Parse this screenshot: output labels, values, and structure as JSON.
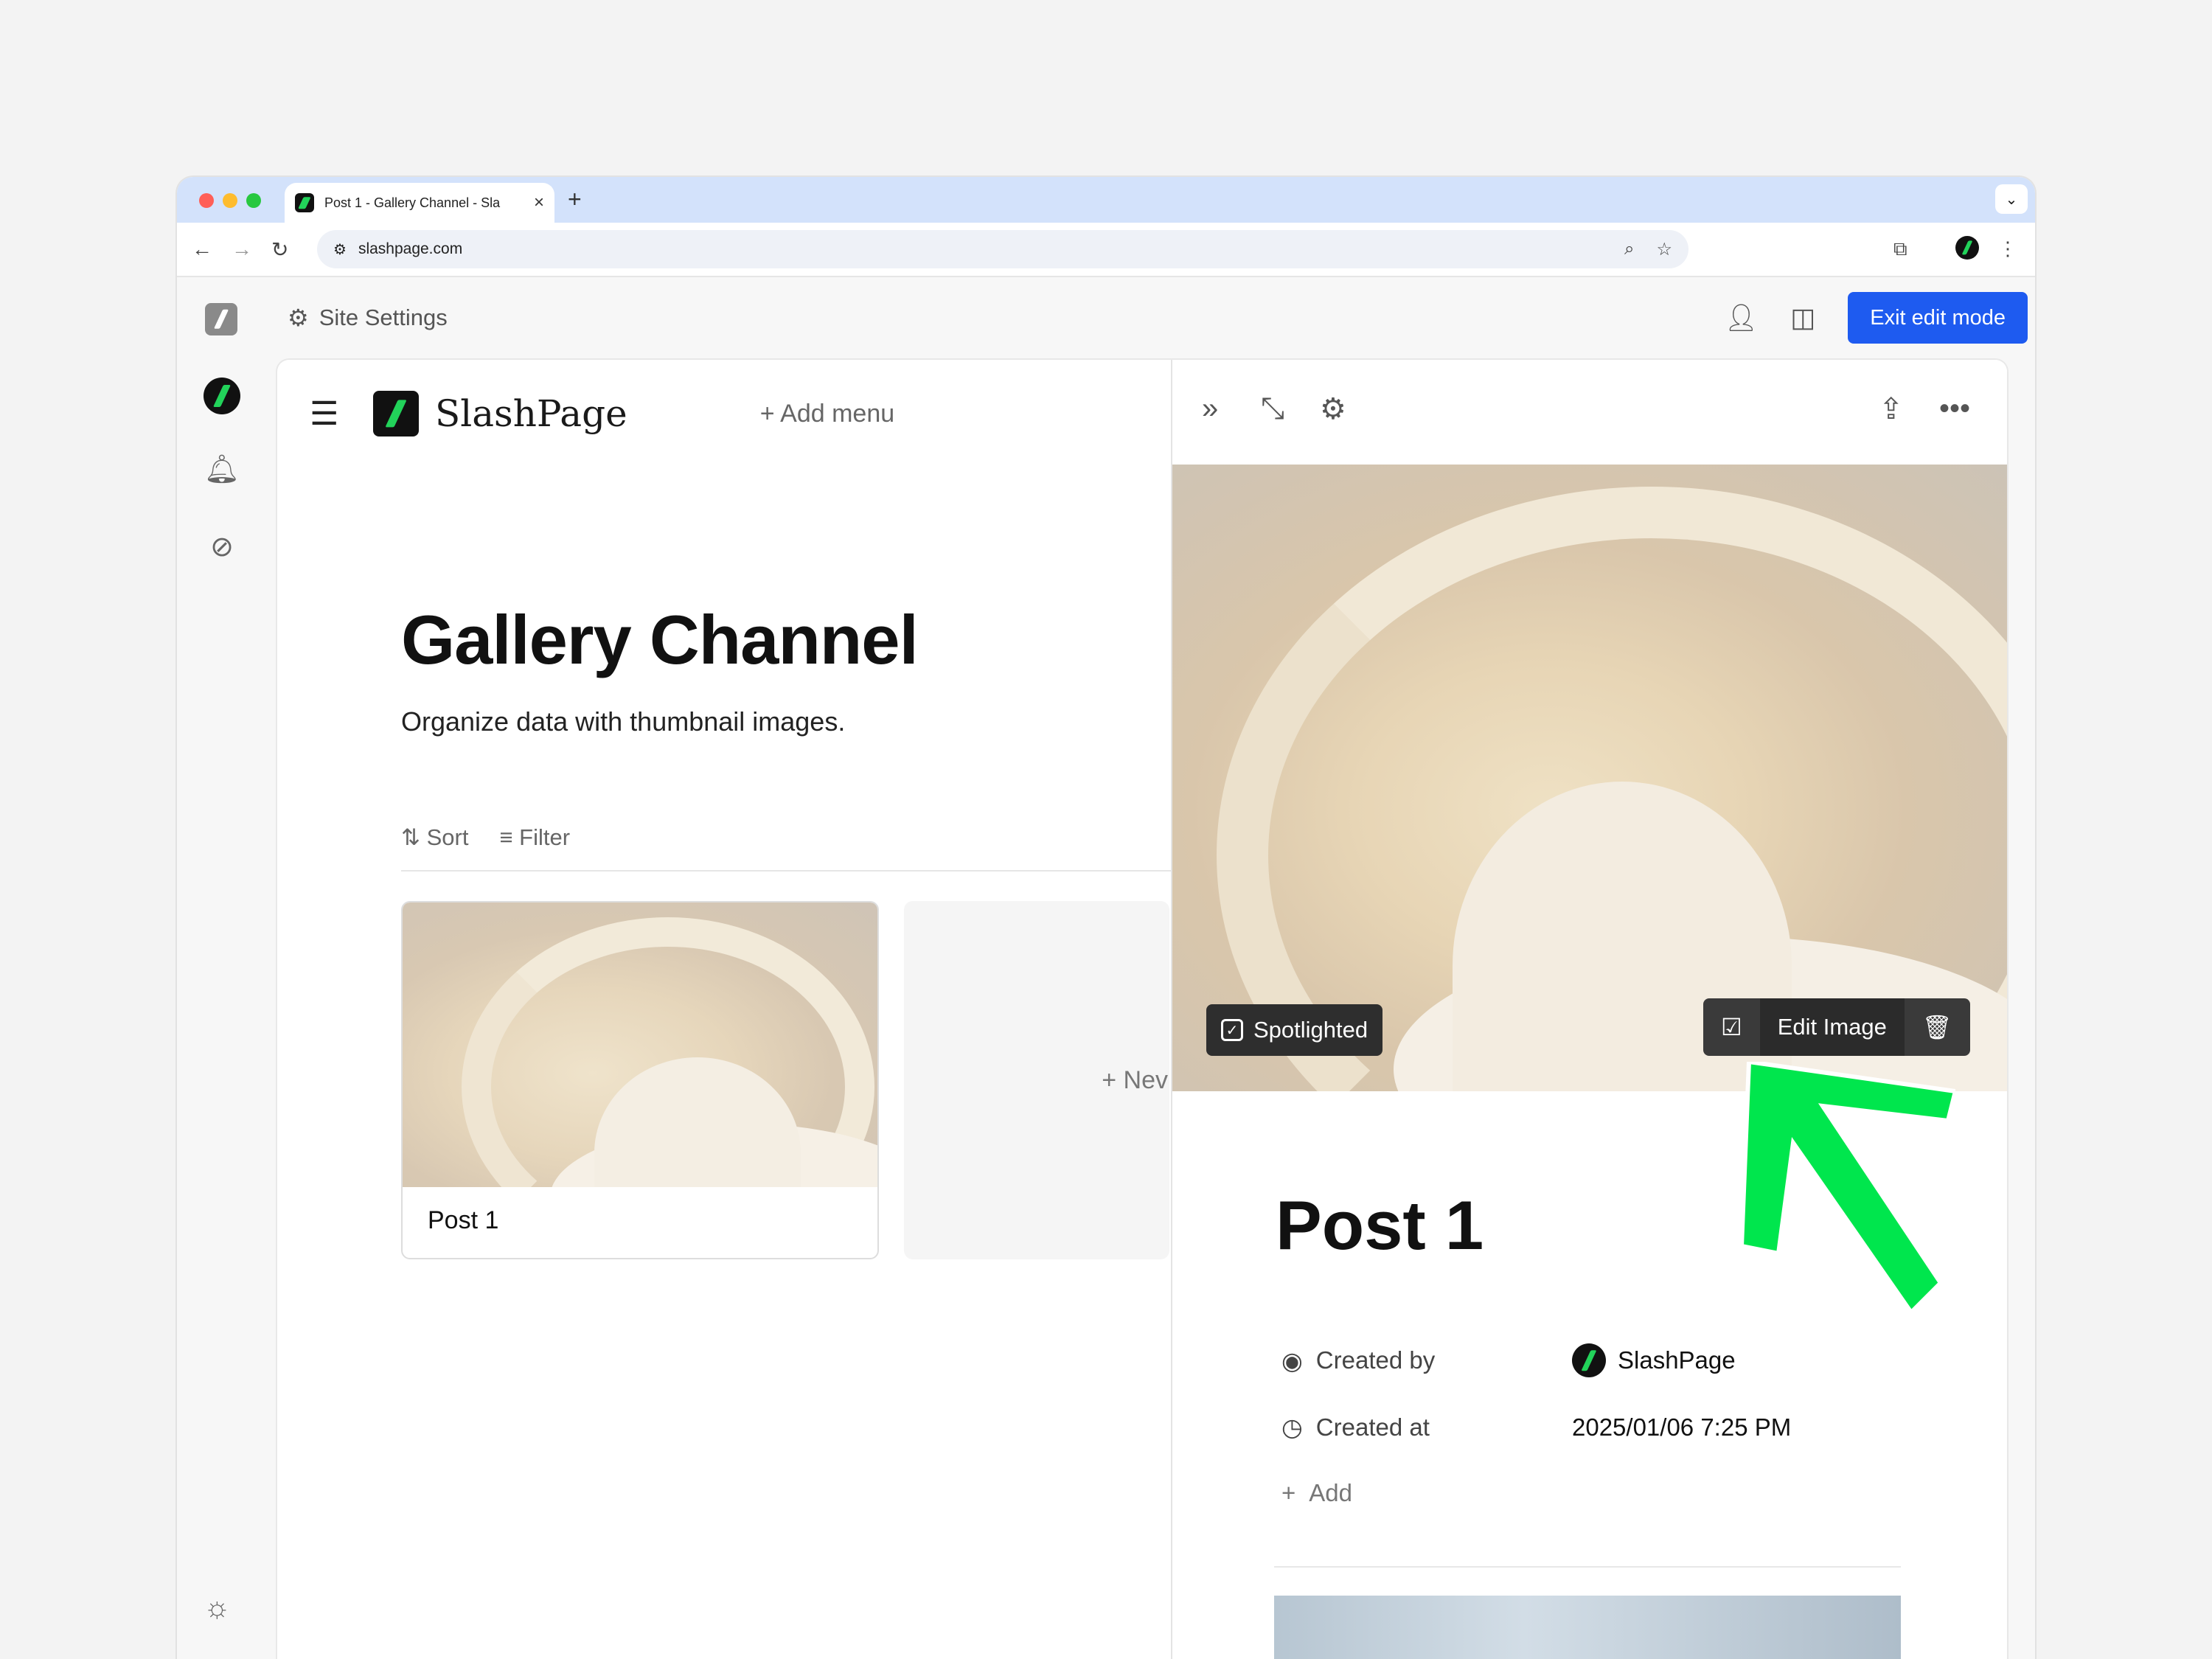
{
  "browser": {
    "tab_title": "Post 1 - Gallery Channel - Sla",
    "tab_close": "×",
    "new_tab": "+",
    "url": "slashpage.com"
  },
  "app": {
    "site_settings_label": "Site Settings",
    "exit_edit_label": "Exit edit mode"
  },
  "site": {
    "brand_name": "SlashPage",
    "add_menu_label": "+ Add menu"
  },
  "gallery": {
    "title": "Gallery Channel",
    "description": "Organize data with thumbnail images.",
    "sort_label": "Sort",
    "filter_label": "Filter",
    "cards": [
      {
        "title": "Post 1"
      }
    ],
    "new_card_label": "+ Nev"
  },
  "panel": {
    "spotlighted_label": "Spotlighted",
    "edit_image_label": "Edit Image",
    "post_title": "Post 1",
    "props": {
      "created_by_label": "Created by",
      "created_by_value": "SlashPage",
      "created_at_label": "Created at",
      "created_at_value": "2025/01/06 7:25 PM",
      "add_label": "Add"
    }
  },
  "colors": {
    "accent_blue": "#1e5bf0",
    "brand_green": "#22d35a",
    "annotation_arrow": "#00e64d"
  }
}
